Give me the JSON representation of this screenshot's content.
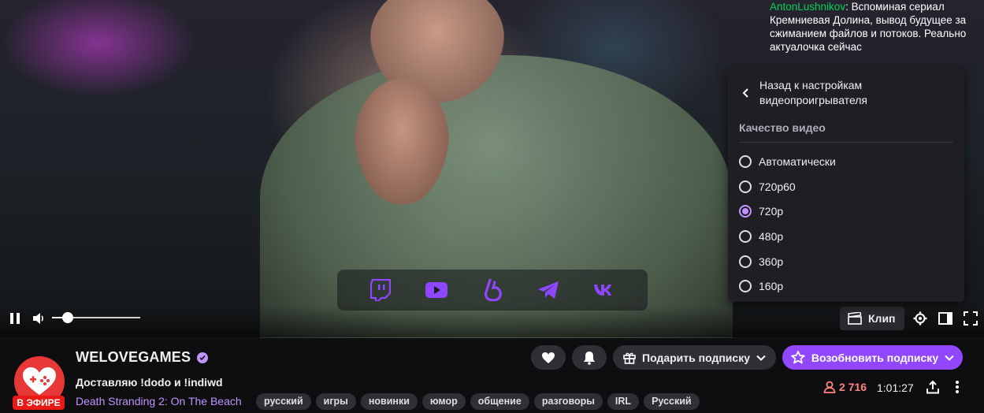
{
  "chat": {
    "user": "AntonLushnikov",
    "message": ": Вспоминая сериал Кремниевая Долина, вывод будущее за сжиманием файлов и потоков. Реально актуалочка сейчас"
  },
  "player": {
    "volume": 0.18,
    "clip_label": "Клип"
  },
  "settings_menu": {
    "back_label": "Назад к настройкам видеопроигрывателя",
    "section_title": "Качество видео",
    "options": [
      "Автоматически",
      "720p60",
      "720p",
      "480p",
      "360p",
      "160p"
    ],
    "selected": "720p"
  },
  "social_icons": [
    "twitch-icon",
    "youtube-icon",
    "boosty-icon",
    "telegram-icon",
    "vk-icon"
  ],
  "channel": {
    "name": "WELOVEGAMES",
    "live_badge": "В ЭФИРЕ",
    "stream_title": "Доставляю !dodo и !indiwd",
    "category": "Death Stranding 2: On The Beach",
    "tags": [
      "русский",
      "игры",
      "новинки",
      "юмор",
      "общение",
      "разговоры",
      "IRL",
      "Русский"
    ],
    "viewers": "2 716",
    "uptime": "1:01:27"
  },
  "buttons": {
    "gift_sub": "Подарить подписку",
    "resub": "Возобновить подписку"
  },
  "colors": {
    "accent": "#9147ff",
    "accent_light": "#bf94ff",
    "live": "#e91916",
    "viewers": "#ff8280",
    "chat_user": "#00d35a"
  }
}
